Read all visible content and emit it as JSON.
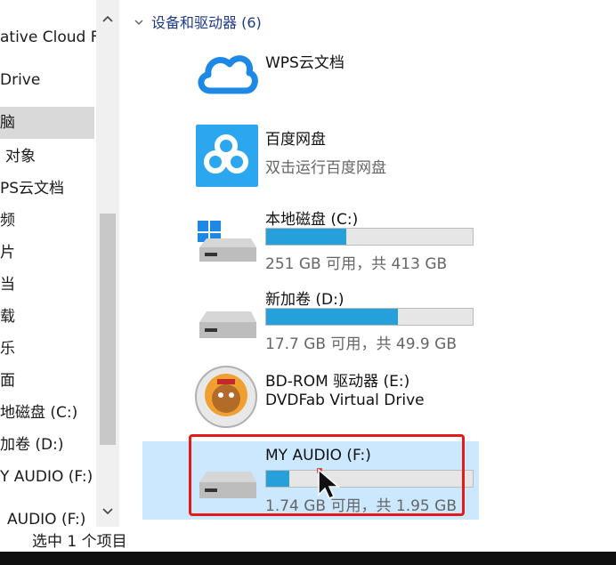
{
  "nav": {
    "items": [
      {
        "label": "ative Cloud Fi"
      },
      {
        "label": "Drive"
      },
      {
        "label": "脑",
        "selected": true
      },
      {
        "label": "对象"
      },
      {
        "label": "PS云文档"
      },
      {
        "label": "频"
      },
      {
        "label": "片"
      },
      {
        "label": "当"
      },
      {
        "label": "载"
      },
      {
        "label": "乐"
      },
      {
        "label": "面"
      },
      {
        "label": "地磁盘 (C:)"
      },
      {
        "label": "加卷 (D:)"
      },
      {
        "label": "Y AUDIO (F:)"
      },
      {
        "label": "AUDIO (F:)"
      }
    ]
  },
  "group": {
    "title": "设备和驱动器 (6)"
  },
  "items": [
    {
      "name": "WPS云文档",
      "icon": "cloud-icon"
    },
    {
      "name": "百度网盘",
      "sub": "双击运行百度网盘",
      "icon": "baidu-netdisk-icon"
    },
    {
      "name": "本地磁盘 (C:)",
      "sub": "251 GB 可用，共 413 GB",
      "usage": 0.39,
      "icon": "windows-drive-icon"
    },
    {
      "name": "新加卷 (D:)",
      "sub": "17.7 GB 可用，共 49.9 GB",
      "usage": 0.64,
      "icon": "drive-icon"
    },
    {
      "name": "BD-ROM 驱动器 (E:)",
      "sub": "DVDFab Virtual Drive",
      "icon": "dvdfab-icon"
    },
    {
      "name": "MY AUDIO (F:)",
      "sub": "1.74 GB 可用，共 1.95 GB",
      "usage": 0.11,
      "icon": "usb-drive-icon",
      "selected": true
    }
  ],
  "status": {
    "text": "选中 1 个项目"
  },
  "colors": {
    "accent": "#26a0da",
    "selection": "#cce8ff",
    "highlight": "#e31b1b"
  }
}
